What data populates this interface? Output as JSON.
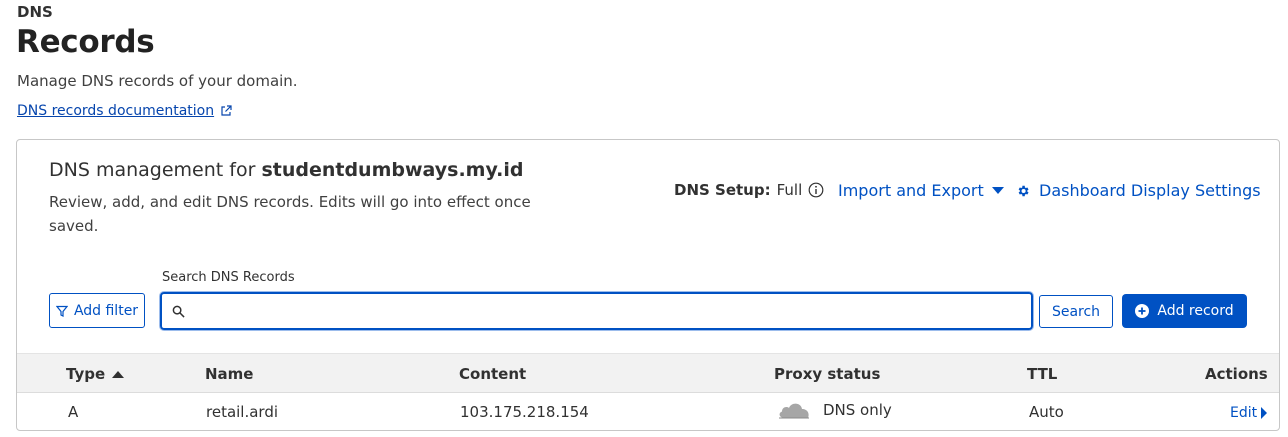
{
  "header": {
    "section": "DNS",
    "title": "Records",
    "description": "Manage DNS records of your domain.",
    "doc_link": "DNS records documentation"
  },
  "card": {
    "title_prefix": "DNS management for ",
    "domain": "studentdumbways.my.id",
    "description": "Review, add, and edit DNS records. Edits will go into effect once saved.",
    "setup_label": "DNS Setup:",
    "setup_value": "Full",
    "import_export": "Import and Export",
    "display_settings": "Dashboard Display Settings"
  },
  "search": {
    "label": "Search DNS Records",
    "placeholder": "",
    "value": "",
    "filter_button": "Add filter",
    "search_button": "Search",
    "add_record_button": "Add record"
  },
  "table": {
    "columns": {
      "type": "Type",
      "name": "Name",
      "content": "Content",
      "proxy": "Proxy status",
      "ttl": "TTL",
      "actions": "Actions"
    },
    "rows": [
      {
        "type": "A",
        "name": "retail.ardi",
        "content": "103.175.218.154",
        "proxy": "DNS only",
        "ttl": "Auto",
        "action": "Edit"
      }
    ]
  },
  "icons": {
    "external_link": "external-link-icon",
    "info": "info-icon",
    "caret": "caret-down-icon",
    "gear": "gear-icon",
    "filter": "filter-icon",
    "search": "search-icon",
    "plus": "plus-circle-icon",
    "sort": "sort-asc-icon",
    "cloud": "cloud-dns-only-icon",
    "edit_caret": "caret-right-icon"
  },
  "colors": {
    "accent": "#0051c3",
    "text": "#313131",
    "header_bg": "#f2f2f2",
    "cloud_gray": "#929292"
  }
}
